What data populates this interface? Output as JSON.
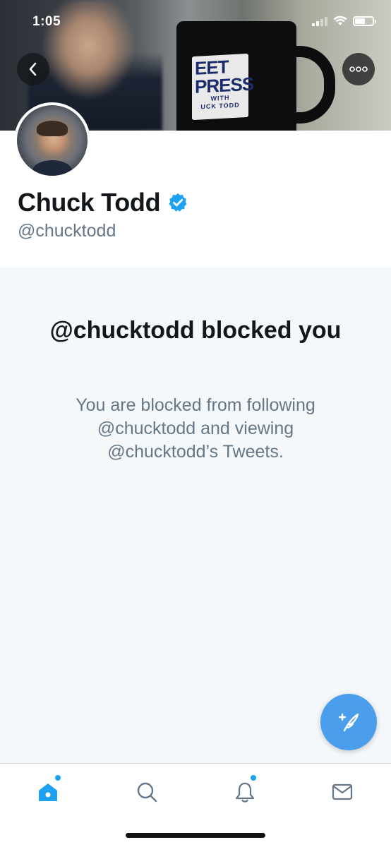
{
  "status_bar": {
    "time": "1:05"
  },
  "header": {
    "banner_logo_line1": "EET",
    "banner_logo_line2": "PRESS",
    "banner_logo_sub1": "WITH",
    "banner_logo_sub2": "UCK TODD",
    "back_icon": "chevron-left-icon",
    "more_icon": "more-horizontal-icon"
  },
  "profile": {
    "name": "Chuck Todd",
    "handle": "@chucktodd",
    "verified": true,
    "verified_color": "#1da1f2"
  },
  "blocked": {
    "title": "@chucktodd blocked you",
    "description": "You are blocked from following @chucktodd and viewing @chucktodd’s Tweets."
  },
  "compose": {
    "icon": "compose-tweet-icon",
    "color": "#4a9eeb"
  },
  "tabbar": {
    "items": [
      {
        "name": "home",
        "icon": "home-icon",
        "active": true,
        "has_dot": true
      },
      {
        "name": "search",
        "icon": "search-icon",
        "active": false,
        "has_dot": false
      },
      {
        "name": "notifications",
        "icon": "bell-icon",
        "active": false,
        "has_dot": true
      },
      {
        "name": "messages",
        "icon": "mail-icon",
        "active": false,
        "has_dot": false
      }
    ],
    "accent": "#1da1f2",
    "inactive": "#657786"
  }
}
